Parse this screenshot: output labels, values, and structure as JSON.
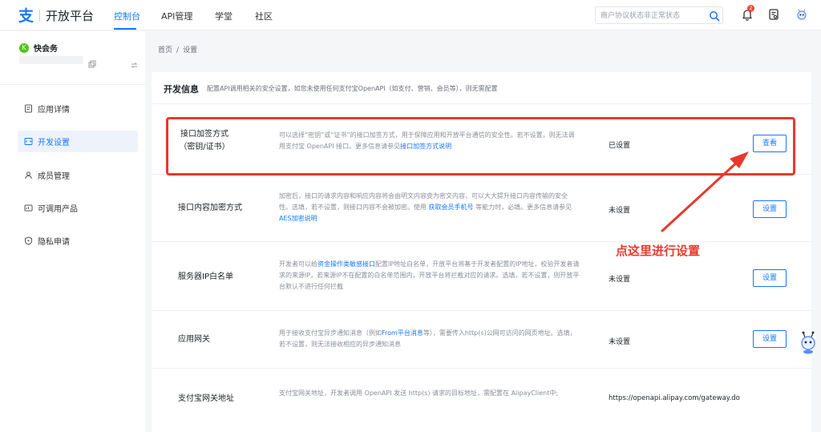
{
  "header": {
    "brand": "开放平台",
    "tabs": [
      {
        "label": "控制台",
        "active": true
      },
      {
        "label": "API管理",
        "active": false
      },
      {
        "label": "学堂",
        "active": false
      },
      {
        "label": "社区",
        "active": false
      }
    ],
    "search_placeholder": "商户协议状态非正常状态",
    "notification_count": "2",
    "accent_color": "#1677ff"
  },
  "sidebar": {
    "app_name": "快会务",
    "app_logo_letter": "K",
    "items": [
      {
        "label": "应用详情",
        "icon": "doc-icon",
        "active": false
      },
      {
        "label": "开发设置",
        "icon": "code-settings-icon",
        "active": true
      },
      {
        "label": "成员管理",
        "icon": "members-icon",
        "active": false
      },
      {
        "label": "可调用产品",
        "icon": "product-icon",
        "active": false
      },
      {
        "label": "隐私申请",
        "icon": "privacy-shield-icon",
        "active": false
      }
    ]
  },
  "breadcrumb": {
    "home": "首页",
    "separator": "/",
    "current": "设置"
  },
  "card": {
    "title": "开发信息",
    "description": "配置API调用相关的安全设置，如您未使用任何支付宝OpenAPI（如支付、营销、会员等），则无需配置"
  },
  "rows": [
    {
      "label_line1": "接口加签方式",
      "label_line2": "（密钥/证书）",
      "desc_pre": "可以选择“密钥”或“证书”的接口加签方式，用于保障应用和开放平台通信的安全性。若不设置，则无法调用支付宝 OpenAPI 接口。更多信息请参见",
      "desc_link": "接口加签方式说明",
      "desc_post": "",
      "status": "已设置",
      "button": "查看"
    },
    {
      "label_line1": "接口内容加密方式",
      "desc_pre": "加密后，接口的请求内容和响应内容将会由明文内容变为密文内容，可以大大提升接口内容传输的安全性。选填，若不设置，则接口内容不会被加密。使用",
      "desc_link": "获取会员手机号",
      "desc_mid": "等能力时，必填。更多信息请参见",
      "desc_link2": "AES加密说明",
      "status": "未设置",
      "button": "设置"
    },
    {
      "label_line1": "服务器IP白名单",
      "desc_pre": "开发者可以给",
      "desc_link": "资金操作类敏感接口",
      "desc_post": "配置IP地址白名单，开放平台将基于开发者配置的IP地址，校验开发者请求的来源IP，若来源IP不在配置的白名单范围内，开放平台将拦截对应的请求。选填，若不设置，则开放平台默认不进行任何拦截",
      "status": "未设置",
      "button": "设置"
    },
    {
      "label_line1": "应用网关",
      "desc_pre": "用于接收支付宝异步通知消息（例如",
      "desc_link": "From平台消息",
      "desc_post": "等），需要传入http(s)公网可访问的网页地址。选填，若不设置，则无法接收相应的异步通知消息",
      "status": "未设置",
      "button": "设置"
    },
    {
      "label_line1": "支付宝网关地址",
      "desc_pre": "支付宝网关地址，开发者调用 OpenAPI 发送 http(s) 请求的目标地址，需配置在 AlipayClient中;",
      "status": "https://openapi.alipay.com/gateway.do"
    }
  ],
  "annotation": {
    "text": "点这里进行设置",
    "color": "#e8392c"
  }
}
